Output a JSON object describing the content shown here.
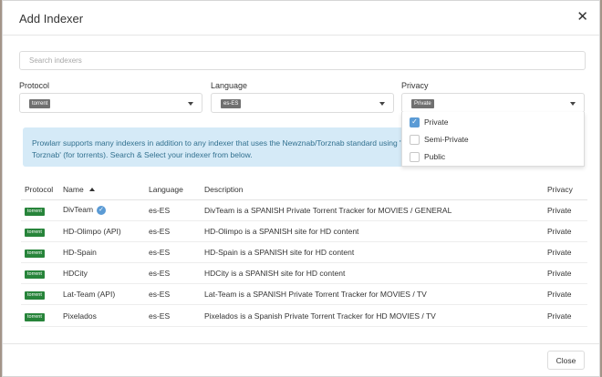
{
  "modal": {
    "title": "Add Indexer"
  },
  "search": {
    "placeholder": "Search indexers"
  },
  "filters": {
    "protocol": {
      "label": "Protocol",
      "value": "torrent"
    },
    "language": {
      "label": "Language",
      "value": "es-ES"
    },
    "privacy": {
      "label": "Privacy",
      "value": "Private",
      "options": [
        {
          "label": "Private",
          "checked": true
        },
        {
          "label": "Semi-Private",
          "checked": false
        },
        {
          "label": "Public",
          "checked": false
        }
      ]
    }
  },
  "info": {
    "line1": "Prowlarr supports many indexers in addition to any indexer that uses the Newznab/Torznab standard using 'Generic Newznab' (for usenet) or 'Generic",
    "line2": "Torznab' (for torrents). Search & Select your indexer from below."
  },
  "table": {
    "headers": {
      "protocol": "Protocol",
      "name": "Name",
      "language": "Language",
      "description": "Description",
      "privacy": "Privacy"
    },
    "rows": [
      {
        "protocol": "torrent",
        "name": "DivTeam",
        "verified": true,
        "language": "es-ES",
        "description": "DivTeam is a SPANISH Private Torrent Tracker for MOVIES / GENERAL",
        "privacy": "Private"
      },
      {
        "protocol": "torrent",
        "name": "HD-Olimpo (API)",
        "verified": false,
        "language": "es-ES",
        "description": "HD-Olimpo is a SPANISH site for HD content",
        "privacy": "Private"
      },
      {
        "protocol": "torrent",
        "name": "HD-Spain",
        "verified": false,
        "language": "es-ES",
        "description": "HD-Spain is a SPANISH site for HD content",
        "privacy": "Private"
      },
      {
        "protocol": "torrent",
        "name": "HDCity",
        "verified": false,
        "language": "es-ES",
        "description": "HDCity is a SPANISH site for HD content",
        "privacy": "Private"
      },
      {
        "protocol": "torrent",
        "name": "Lat-Team (API)",
        "verified": false,
        "language": "es-ES",
        "description": "Lat-Team is a SPANISH Private Torrent Tracker for MOVIES / TV",
        "privacy": "Private"
      },
      {
        "protocol": "torrent",
        "name": "Pixelados",
        "verified": false,
        "language": "es-ES",
        "description": "Pixelados is a Spanish Private Torrent Tracker for HD MOVIES / TV",
        "privacy": "Private"
      }
    ]
  },
  "footer": {
    "close_label": "Close"
  },
  "colors": {
    "torrent_chip": "#27843a",
    "info_bg": "#d5eaf7",
    "accent": "#5b9bd5"
  }
}
